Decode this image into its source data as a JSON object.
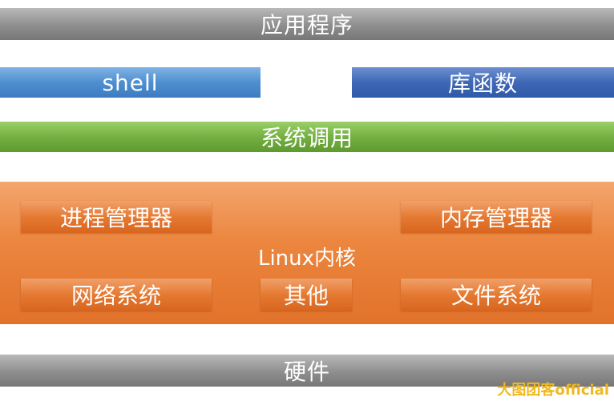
{
  "layers": {
    "applications": "应用程序",
    "shell": "shell",
    "library_functions": "库函数",
    "system_calls": "系统调用",
    "hardware": "硬件"
  },
  "kernel": {
    "label": "Linux内核",
    "modules": {
      "process_manager": "进程管理器",
      "memory_manager": "内存管理器",
      "network_system": "网络系统",
      "other": "其他",
      "file_system": "文件系统"
    }
  },
  "watermark": "大图团客official",
  "colors": {
    "gray": "#8e8e8e",
    "shell_blue": "#4f8fd0",
    "library_blue": "#3e68b6",
    "green": "#74b042",
    "kernel_orange": "#ec8740",
    "watermark": "#f0b820"
  }
}
